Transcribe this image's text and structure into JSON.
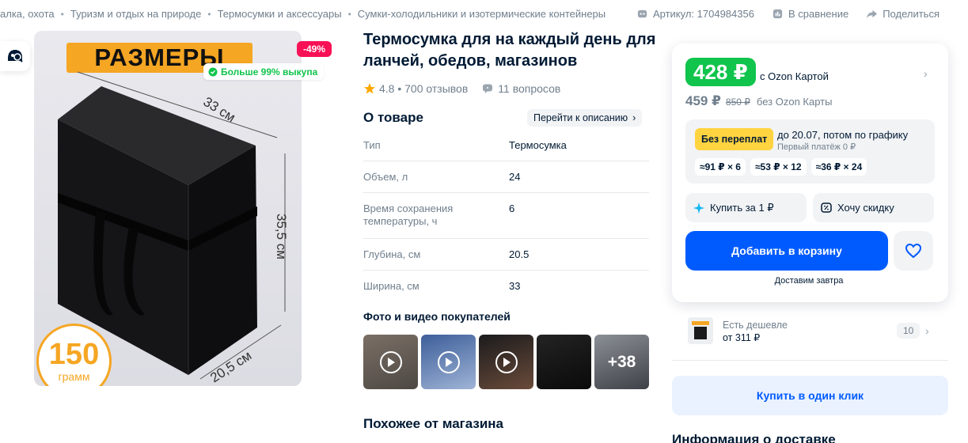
{
  "breadcrumbs": [
    "алка, охота",
    "Туризм и отдых на природе",
    "Термосумки и аксессуары",
    "Сумки-холодильники и изотермические контейнеры"
  ],
  "meta": {
    "article": "Артикул: 1704984356",
    "compare": "В сравнение",
    "share": "Поделиться"
  },
  "product": {
    "title": "Термосумка для на каждый день для ланчей, обедов, магазинов",
    "rating": "4.8 • 700 отзывов",
    "questions": "11 вопросов",
    "discount_badge": "-49%",
    "buyout_badge": "Больше 99% выкупа"
  },
  "photo": {
    "banner": "РАЗМЕРЫ",
    "dim_top": "33 см",
    "dim_right": "35,5 см",
    "dim_bottom": "20,5 см",
    "weight_value": "150",
    "weight_unit": "грамм"
  },
  "about": {
    "heading": "О товаре",
    "goto_label": "Перейти к описанию",
    "specs": [
      {
        "name": "Тип",
        "value": "Термосумка"
      },
      {
        "name": "Объем, л",
        "value": "24"
      },
      {
        "name": "Время сохранения температуры, ч",
        "value": "6"
      },
      {
        "name": "Глубина, см",
        "value": "20.5"
      },
      {
        "name": "Ширина, см",
        "value": "33"
      }
    ]
  },
  "customer_media": {
    "heading": "Фото и видео покупателей",
    "more_label": "+38"
  },
  "similar": {
    "heading": "Похожее от магазина"
  },
  "price_card": {
    "ozon_price": "428 ₽",
    "ozon_card_label": "с Ozon Картой",
    "regular_price": "459 ₽",
    "old_price": "850 ₽",
    "no_card_label": "без Ozon Карты",
    "installment_badge": "Без переплат",
    "installment_until": "до 20.07, потом по графику",
    "installment_first": "Первый платёж 0 ₽",
    "plans": [
      "≈91 ₽ × 6",
      "≈53 ₽ × 12",
      "≈36 ₽ × 24"
    ],
    "buy_for_1": "Купить за 1 ₽",
    "want_discount": "Хочу скидку",
    "add_to_cart": "Добавить в корзину",
    "delivery_note": "Доставим завтра"
  },
  "cheaper": {
    "label": "Есть дешевле",
    "price": "от 311 ₽",
    "count": "10"
  },
  "one_click": "Купить в один клик",
  "delivery_heading": "Информация о доставке",
  "colors": {
    "brand_blue": "#005bff",
    "price_green": "#10c44c",
    "discount_pink": "#f91155",
    "installment_yellow": "#ffd440"
  }
}
